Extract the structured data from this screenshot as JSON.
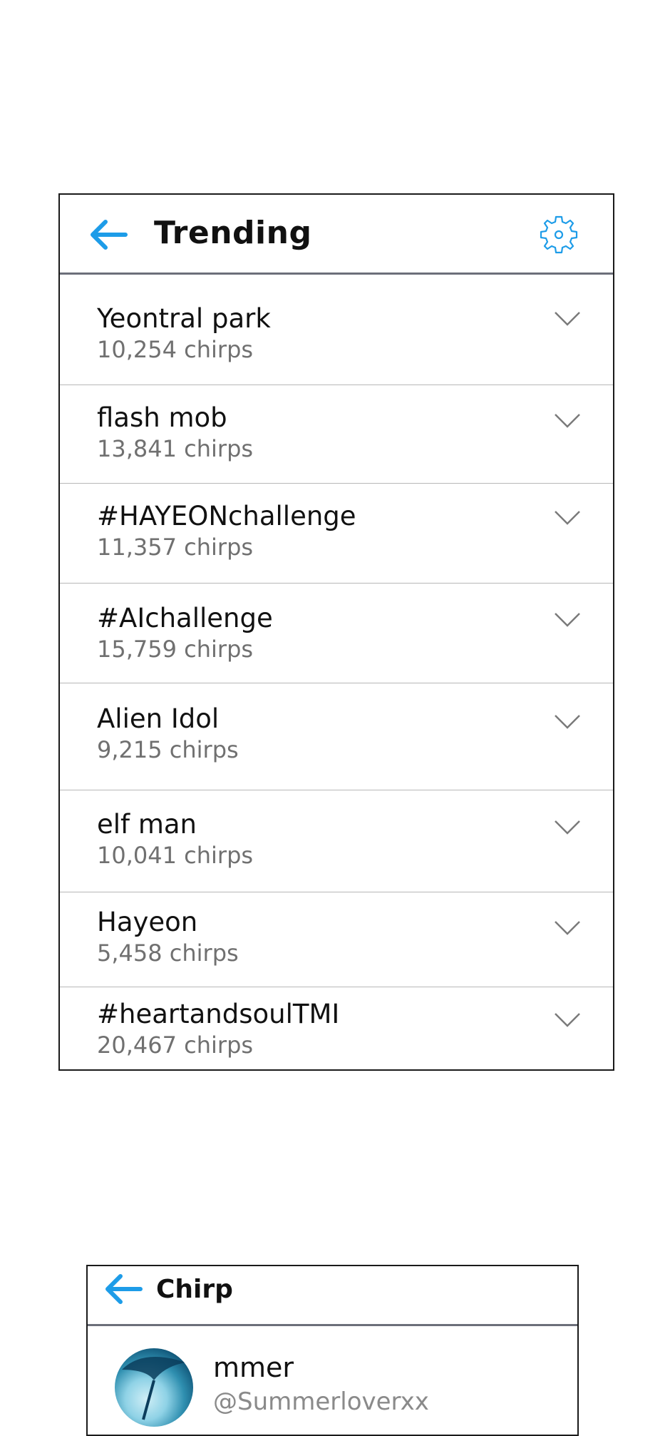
{
  "trending": {
    "title": "Trending",
    "icons": {
      "back": "arrow-left-icon",
      "settings": "gear-icon",
      "expand": "chevron-down-icon"
    },
    "accent_color": "#1d9ce8",
    "items": [
      {
        "topic": "Yeontral park",
        "count": "10,254 chirps"
      },
      {
        "topic": "flash mob",
        "count": "13,841 chirps"
      },
      {
        "topic": "#HAYEONchallenge",
        "count": "11,357 chirps"
      },
      {
        "topic": "#AIchallenge",
        "count": "15,759 chirps"
      },
      {
        "topic": "Alien Idol",
        "count": "9,215 chirps"
      },
      {
        "topic": "elf man",
        "count": "10,041 chirps"
      },
      {
        "topic": "Hayeon",
        "count": "5,458 chirps"
      },
      {
        "topic": "#heartandsoulTMI",
        "count": "20,467 chirps"
      }
    ]
  },
  "chirp": {
    "title": "Chirp",
    "author": "mmer",
    "handle": "@Summerloverxx"
  }
}
